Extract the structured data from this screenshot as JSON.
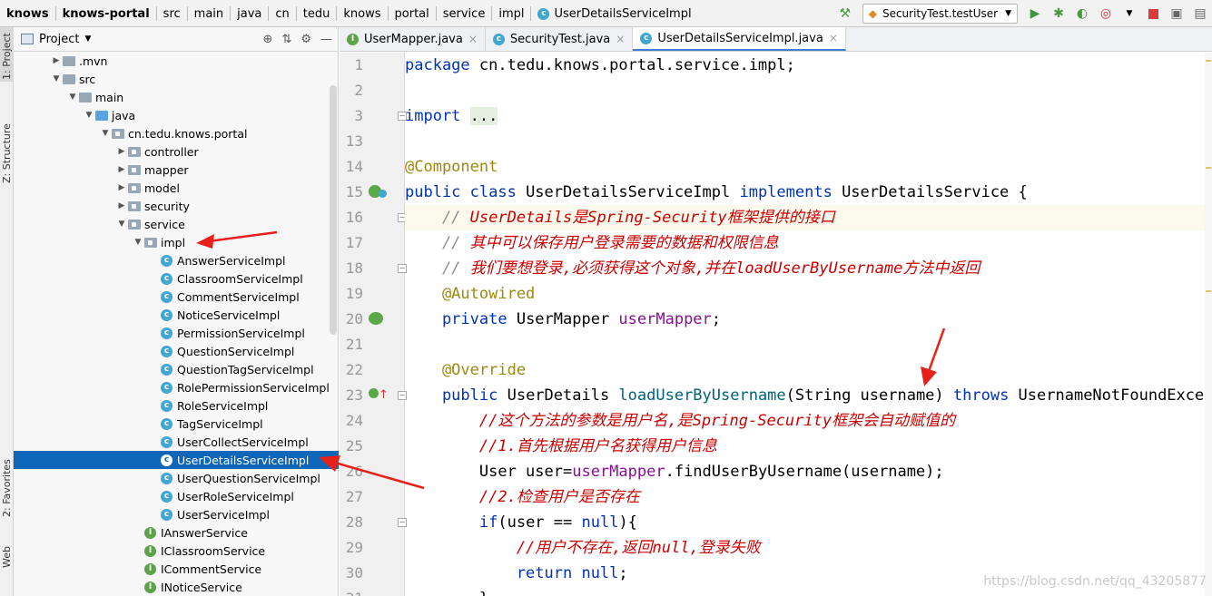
{
  "breadcrumbs": [
    "knows",
    "knows-portal",
    "src",
    "main",
    "java",
    "cn",
    "tedu",
    "knows",
    "portal",
    "service",
    "impl",
    "UserDetailsServiceImpl"
  ],
  "run_config": "SecurityTest.testUser",
  "left_strip": {
    "project_tab": "1: Project",
    "structure_tab": "Z: Structure",
    "favorites_tab": "2: Favorites",
    "web_tab": "Web"
  },
  "project_panel": {
    "title": "Project"
  },
  "tree": [
    {
      "label": ".mvn",
      "indent": 1,
      "arrow": "▶",
      "kind": "folder"
    },
    {
      "label": "src",
      "indent": 1,
      "arrow": "▼",
      "kind": "folder"
    },
    {
      "label": "main",
      "indent": 2,
      "arrow": "▼",
      "kind": "folder"
    },
    {
      "label": "java",
      "indent": 3,
      "arrow": "▼",
      "kind": "folder-blue"
    },
    {
      "label": "cn.tedu.knows.portal",
      "indent": 4,
      "arrow": "▼",
      "kind": "package"
    },
    {
      "label": "controller",
      "indent": 5,
      "arrow": "▶",
      "kind": "package"
    },
    {
      "label": "mapper",
      "indent": 5,
      "arrow": "▶",
      "kind": "package"
    },
    {
      "label": "model",
      "indent": 5,
      "arrow": "▶",
      "kind": "package"
    },
    {
      "label": "security",
      "indent": 5,
      "arrow": "▶",
      "kind": "package"
    },
    {
      "label": "service",
      "indent": 5,
      "arrow": "▼",
      "kind": "package"
    },
    {
      "label": "impl",
      "indent": 6,
      "arrow": "▼",
      "kind": "package"
    },
    {
      "label": "AnswerServiceImpl",
      "indent": 7,
      "arrow": "",
      "kind": "class"
    },
    {
      "label": "ClassroomServiceImpl",
      "indent": 7,
      "arrow": "",
      "kind": "class"
    },
    {
      "label": "CommentServiceImpl",
      "indent": 7,
      "arrow": "",
      "kind": "class"
    },
    {
      "label": "NoticeServiceImpl",
      "indent": 7,
      "arrow": "",
      "kind": "class"
    },
    {
      "label": "PermissionServiceImpl",
      "indent": 7,
      "arrow": "",
      "kind": "class"
    },
    {
      "label": "QuestionServiceImpl",
      "indent": 7,
      "arrow": "",
      "kind": "class"
    },
    {
      "label": "QuestionTagServiceImpl",
      "indent": 7,
      "arrow": "",
      "kind": "class"
    },
    {
      "label": "RolePermissionServiceImpl",
      "indent": 7,
      "arrow": "",
      "kind": "class"
    },
    {
      "label": "RoleServiceImpl",
      "indent": 7,
      "arrow": "",
      "kind": "class"
    },
    {
      "label": "TagServiceImpl",
      "indent": 7,
      "arrow": "",
      "kind": "class"
    },
    {
      "label": "UserCollectServiceImpl",
      "indent": 7,
      "arrow": "",
      "kind": "class"
    },
    {
      "label": "UserDetailsServiceImpl",
      "indent": 7,
      "arrow": "",
      "kind": "class",
      "selected": true
    },
    {
      "label": "UserQuestionServiceImpl",
      "indent": 7,
      "arrow": "",
      "kind": "class"
    },
    {
      "label": "UserRoleServiceImpl",
      "indent": 7,
      "arrow": "",
      "kind": "class"
    },
    {
      "label": "UserServiceImpl",
      "indent": 7,
      "arrow": "",
      "kind": "class"
    },
    {
      "label": "IAnswerService",
      "indent": 6,
      "arrow": "",
      "kind": "interface"
    },
    {
      "label": "IClassroomService",
      "indent": 6,
      "arrow": "",
      "kind": "interface"
    },
    {
      "label": "ICommentService",
      "indent": 6,
      "arrow": "",
      "kind": "interface"
    },
    {
      "label": "INoticeService",
      "indent": 6,
      "arrow": "",
      "kind": "interface"
    }
  ],
  "tabs": [
    {
      "label": "UserMapper.java",
      "icon": "interface-icon",
      "active": false
    },
    {
      "label": "SecurityTest.java",
      "icon": "test-class-icon",
      "active": false
    },
    {
      "label": "UserDetailsServiceImpl.java",
      "icon": "class-icon",
      "active": true
    }
  ],
  "code_lines": [
    {
      "num": "1",
      "parts": [
        [
          "kw",
          "package "
        ],
        [
          "",
          "cn.tedu.knows.portal.service.impl;"
        ]
      ]
    },
    {
      "num": "2",
      "parts": []
    },
    {
      "num": "3",
      "parts": [
        [
          "kw",
          "import "
        ],
        [
          "fold-g",
          "..."
        ]
      ],
      "fold": true
    },
    {
      "num": "13",
      "parts": []
    },
    {
      "num": "14",
      "parts": [
        [
          "ann",
          "@Component"
        ]
      ]
    },
    {
      "num": "15",
      "parts": [
        [
          "kw",
          "public class "
        ],
        [
          "",
          "UserDetailsServiceImpl "
        ],
        [
          "kw",
          "implements "
        ],
        [
          "",
          "UserDetailsService {"
        ]
      ],
      "gutter": "bean"
    },
    {
      "num": "16",
      "parts": [
        [
          "cmt",
          "    // "
        ],
        [
          "cmtzh",
          "UserDetails是Spring-Security框架提供的接口"
        ]
      ],
      "fold": true,
      "current": true
    },
    {
      "num": "17",
      "parts": [
        [
          "cmt",
          "    // "
        ],
        [
          "cmtzh",
          "其中可以保存用户登录需要的数据和权限信息"
        ]
      ]
    },
    {
      "num": "18",
      "parts": [
        [
          "cmt",
          "    // "
        ],
        [
          "cmtzh",
          "我们要想登录,必须获得这个对象,并在loadUserByUsername方法中返回"
        ]
      ],
      "fold": true
    },
    {
      "num": "19",
      "parts": [
        [
          "ann",
          "    @Autowired"
        ]
      ]
    },
    {
      "num": "20",
      "parts": [
        [
          "kw",
          "    private "
        ],
        [
          "",
          "UserMapper "
        ],
        [
          "fld",
          "userMapper"
        ],
        [
          "",
          ";"
        ]
      ],
      "gutter": "autowire"
    },
    {
      "num": "21",
      "parts": []
    },
    {
      "num": "22",
      "parts": [
        [
          "ann",
          "    @Override"
        ]
      ]
    },
    {
      "num": "23",
      "parts": [
        [
          "kw",
          "    public "
        ],
        [
          "",
          "UserDetails "
        ],
        [
          "mth",
          "loadUserByUsername"
        ],
        [
          "",
          "(String username) "
        ],
        [
          "kw",
          "throws "
        ],
        [
          "",
          "UsernameNotFoundException"
        ]
      ],
      "fold": true,
      "gutter": "override"
    },
    {
      "num": "24",
      "parts": [
        [
          "cmtzh",
          "        //这个方法的参数是用户名,是Spring-Security框架会自动赋值的"
        ]
      ]
    },
    {
      "num": "25",
      "parts": [
        [
          "cmtzh",
          "        //1.首先根据用户名获得用户信息"
        ]
      ]
    },
    {
      "num": "26",
      "parts": [
        [
          "",
          "        User user="
        ],
        [
          "fld",
          "userMapper"
        ],
        [
          "",
          ".findUserByUsername(username);"
        ]
      ]
    },
    {
      "num": "27",
      "parts": [
        [
          "cmtzh",
          "        //2.检查用户是否存在"
        ]
      ]
    },
    {
      "num": "28",
      "parts": [
        [
          "kw",
          "        if"
        ],
        [
          "",
          "(user == "
        ],
        [
          "kw",
          "null"
        ],
        [
          "",
          "){"
        ]
      ],
      "fold": true
    },
    {
      "num": "29",
      "parts": [
        [
          "cmtzh",
          "            //用户不存在,返回null,登录失败"
        ]
      ]
    },
    {
      "num": "30",
      "parts": [
        [
          "kw",
          "            return null"
        ],
        [
          "",
          ";"
        ]
      ]
    },
    {
      "num": "31",
      "parts": [
        [
          "",
          "        }"
        ]
      ]
    }
  ],
  "watermark": "https://blog.csdn.net/qq_43205877"
}
